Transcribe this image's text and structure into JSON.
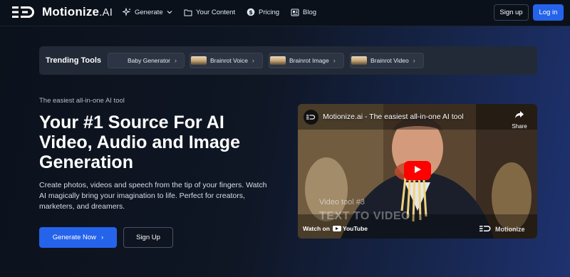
{
  "brand": {
    "name": "Motionize",
    "suffix": ".AI",
    "logo_icon": "motionize-logo-icon"
  },
  "nav": {
    "items": [
      {
        "label": "Generate",
        "icon": "sparkle-icon",
        "has_dropdown": true
      },
      {
        "label": "Your Content",
        "icon": "folder-icon"
      },
      {
        "label": "Pricing",
        "icon": "dollar-icon"
      },
      {
        "label": "Blog",
        "icon": "blog-icon"
      }
    ],
    "signup_label": "Sign up",
    "login_label": "Log in"
  },
  "trending": {
    "label": "Trending Tools",
    "tools": [
      {
        "label": "Baby Generator"
      },
      {
        "label": "Brainrot Voice"
      },
      {
        "label": "Brainrot Image"
      },
      {
        "label": "Brainrot Video"
      }
    ]
  },
  "hero": {
    "tagline": "The easiest all-in-one AI tool",
    "headline": "Your #1 Source For AI Video, Audio and Image Generation",
    "description": "Create photos, videos and speech from the tip of your fingers. Watch AI magically bring your imagination to life. Perfect for creators, marketers, and dreamers.",
    "primary_cta": "Generate Now",
    "secondary_cta": "Sign Up"
  },
  "video": {
    "title": "Motionize.ai - The easiest all-in-one AI tool",
    "share_label": "Share",
    "overlay_line1": "Video tool #3",
    "overlay_line2": "TEXT TO VIDEO",
    "watch_on": "Watch on",
    "youtube": "YouTube",
    "brand_watermark": "Motionize"
  },
  "colors": {
    "accent": "#2563eb",
    "youtube_red": "#ff0000"
  }
}
